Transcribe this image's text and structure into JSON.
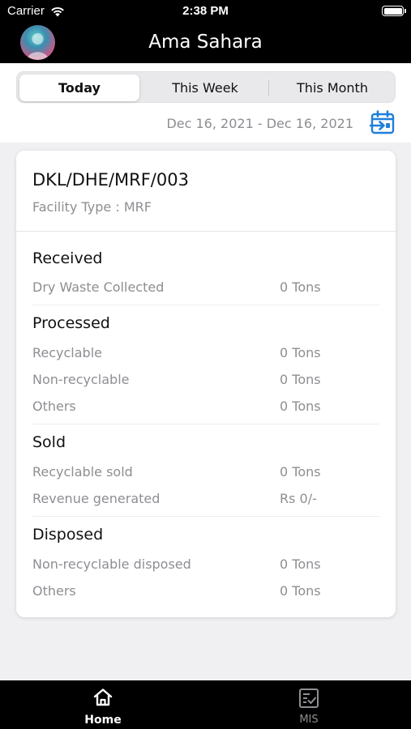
{
  "status_bar": {
    "carrier": "Carrier",
    "time": "2:38 PM"
  },
  "header": {
    "title": "Ama Sahara",
    "avatar_icon": "user-avatar"
  },
  "period_tabs": [
    {
      "label": "Today",
      "selected": true
    },
    {
      "label": "This Week",
      "selected": false
    },
    {
      "label": "This Month",
      "selected": false
    }
  ],
  "date_range": "Dec 16, 2021 - Dec 16, 2021",
  "calendar_icon": "calendar-arrow-icon",
  "facility": {
    "id": "DKL/DHE/MRF/003",
    "type": "Facility Type : MRF"
  },
  "sections": {
    "received": {
      "title": "Received",
      "rows": [
        {
          "label": "Dry Waste Collected",
          "value": "0 Tons"
        }
      ]
    },
    "processed": {
      "title": "Processed",
      "rows": [
        {
          "label": "Recyclable",
          "value": "0 Tons"
        },
        {
          "label": "Non-recyclable",
          "value": "0 Tons"
        },
        {
          "label": "Others",
          "value": "0 Tons"
        }
      ]
    },
    "sold": {
      "title": "Sold",
      "rows": [
        {
          "label": "Recyclable sold",
          "value": "0 Tons"
        },
        {
          "label": "Revenue generated",
          "value": "Rs 0/-"
        }
      ]
    },
    "disposed": {
      "title": "Disposed",
      "rows": [
        {
          "label": "Non-recyclable disposed",
          "value": "0 Tons"
        },
        {
          "label": "Others",
          "value": "0 Tons"
        }
      ]
    }
  },
  "tab_bar": [
    {
      "label": "Home",
      "icon": "home-icon",
      "active": true
    },
    {
      "label": "MIS",
      "icon": "report-checklist-icon",
      "active": false
    }
  ],
  "colors": {
    "accent": "#1e7fd9",
    "header_bg": "#000000",
    "muted_text": "#8e8e93"
  }
}
